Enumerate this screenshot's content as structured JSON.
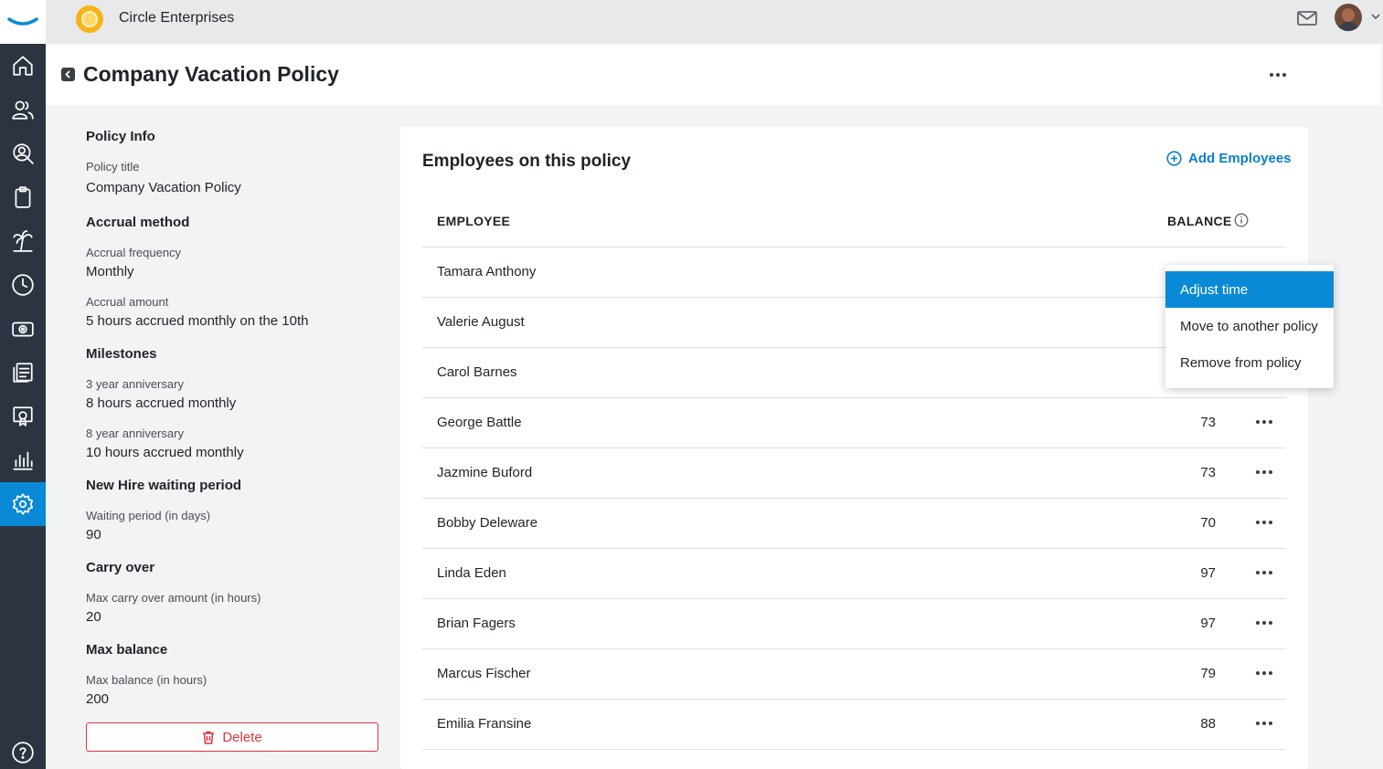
{
  "topbar": {
    "company_name": "Circle Enterprises"
  },
  "header": {
    "title": "Company Vacation Policy"
  },
  "sidebar": {
    "items": [
      {
        "icon": "home-icon"
      },
      {
        "icon": "people-icon"
      },
      {
        "icon": "search-person-icon"
      },
      {
        "icon": "clipboard-icon"
      },
      {
        "icon": "palm-tree-icon"
      },
      {
        "icon": "clock-icon"
      },
      {
        "icon": "money-icon"
      },
      {
        "icon": "documents-icon"
      },
      {
        "icon": "certificate-icon"
      },
      {
        "icon": "bar-chart-icon"
      },
      {
        "icon": "settings-icon",
        "active": true
      },
      {
        "icon": "help-icon"
      }
    ]
  },
  "policy_info": {
    "heading": "Policy Info",
    "title_label": "Policy title",
    "title_value": "Company Vacation Policy",
    "accrual_heading": "Accrual method",
    "frequency_label": "Accrual frequency",
    "frequency_value": "Monthly",
    "amount_label": "Accrual amount",
    "amount_value": "5 hours accrued monthly on the 10th",
    "milestones_heading": "Milestones",
    "milestone1_label": "3 year anniversary",
    "milestone1_value": "8 hours accrued monthly",
    "milestone2_label": "8 year anniversary",
    "milestone2_value": "10 hours accrued monthly",
    "waiting_heading": "New Hire waiting period",
    "waiting_label": "Waiting period (in days)",
    "waiting_value": "90",
    "carry_heading": "Carry over",
    "carry_label": "Max carry over amount (in hours)",
    "carry_value": "20",
    "maxbal_heading": "Max balance",
    "maxbal_label": "Max balance (in hours)",
    "maxbal_value": "200",
    "delete_label": "Delete"
  },
  "employees": {
    "title": "Employees on this policy",
    "add_label": "Add Employees",
    "col_employee": "EMPLOYEE",
    "col_balance": "BALANCE",
    "rows": [
      {
        "name": "Tamara Anthony",
        "balance": ""
      },
      {
        "name": "Valerie August",
        "balance": ""
      },
      {
        "name": "Carol Barnes",
        "balance": ""
      },
      {
        "name": "George Battle",
        "balance": "73"
      },
      {
        "name": "Jazmine Buford",
        "balance": "73"
      },
      {
        "name": "Bobby Deleware",
        "balance": "70"
      },
      {
        "name": "Linda Eden",
        "balance": "97"
      },
      {
        "name": "Brian Fagers",
        "balance": "97"
      },
      {
        "name": "Marcus Fischer",
        "balance": "79"
      },
      {
        "name": "Emilia Fransine",
        "balance": "88"
      }
    ]
  },
  "row_menu": {
    "items": [
      "Adjust time",
      "Move to another policy",
      "Remove from policy"
    ],
    "selected": "Adjust time"
  },
  "colors": {
    "accent": "#0a8ad6",
    "danger": "#d9363e",
    "rail": "#2b3440"
  }
}
